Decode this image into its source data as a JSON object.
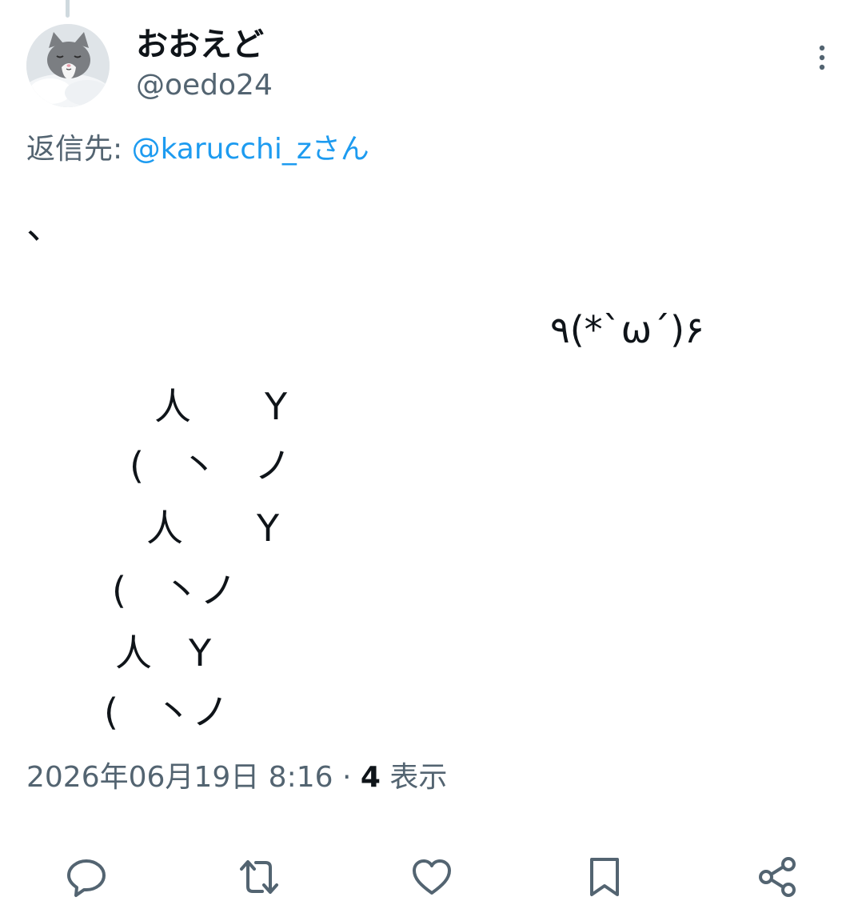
{
  "user": {
    "display_name": "おおえど",
    "handle": "@oedo24"
  },
  "reply": {
    "prefix": "返信先: ",
    "mention": "@karucchi_zさん"
  },
  "body_lines": [
    "、",
    "٩(*`ω´)۶",
    "人　　Y",
    "(　丶　ノ",
    "人　　Y",
    "(　丶ノ",
    "人　Y",
    "(　丶ノ"
  ],
  "meta": {
    "timestamp": "2026年06月19日 8:16",
    "separator": " · ",
    "views_count": "4",
    "views_label": " 表示"
  },
  "icons": {
    "more": "more-vertical-icon",
    "reply": "reply-icon",
    "retweet": "retweet-icon",
    "like": "heart-icon",
    "bookmark": "bookmark-icon",
    "share": "share-icon"
  },
  "colors": {
    "text_primary": "#0f1419",
    "text_secondary": "#536471",
    "link": "#1d9bf0",
    "thread_line": "#cfd9de"
  }
}
